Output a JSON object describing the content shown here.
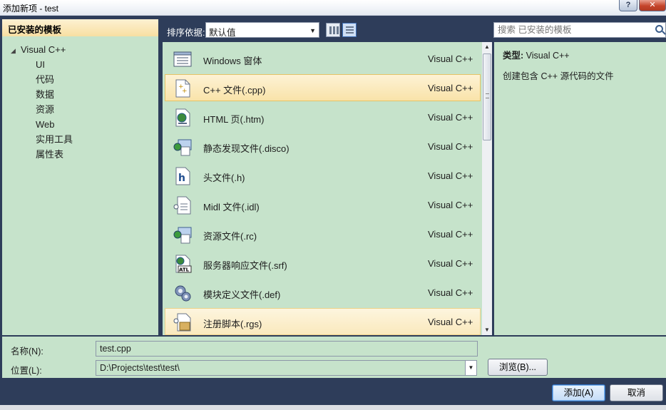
{
  "window": {
    "title": "添加新项 - test",
    "help_button": "?",
    "close_button": "✕"
  },
  "left_panel": {
    "header": "已安装的模板",
    "tree_root": "Visual C++",
    "tree_children": [
      "UI",
      "代码",
      "数据",
      "资源",
      "Web",
      "实用工具",
      "属性表"
    ]
  },
  "sortbar": {
    "label": "排序依据:",
    "selected": "默认值"
  },
  "search": {
    "placeholder": "搜索 已安装的模板"
  },
  "templates": [
    {
      "name": "Windows 窗体",
      "lang": "Visual C++",
      "icon": "windows-form-icon",
      "state": "normal"
    },
    {
      "name": "C++ 文件(.cpp)",
      "lang": "Visual C++",
      "icon": "cpp-file-icon",
      "state": "selected"
    },
    {
      "name": "HTML 页(.htm)",
      "lang": "Visual C++",
      "icon": "html-page-icon",
      "state": "normal"
    },
    {
      "name": "静态发现文件(.disco)",
      "lang": "Visual C++",
      "icon": "disco-file-icon",
      "state": "normal"
    },
    {
      "name": "头文件(.h)",
      "lang": "Visual C++",
      "icon": "header-file-icon",
      "state": "normal"
    },
    {
      "name": "Midl 文件(.idl)",
      "lang": "Visual C++",
      "icon": "midl-file-icon",
      "state": "normal"
    },
    {
      "name": "资源文件(.rc)",
      "lang": "Visual C++",
      "icon": "resource-file-icon",
      "state": "normal"
    },
    {
      "name": "服务器响应文件(.srf)",
      "lang": "Visual C++",
      "icon": "srf-file-icon",
      "state": "normal"
    },
    {
      "name": "模块定义文件(.def)",
      "lang": "Visual C++",
      "icon": "def-file-icon",
      "state": "normal"
    },
    {
      "name": "注册脚本(.rgs)",
      "lang": "Visual C++",
      "icon": "rgs-file-icon",
      "state": "hover"
    }
  ],
  "info": {
    "type_label": "类型:",
    "type_value": "Visual C++",
    "description": "创建包含 C++ 源代码的文件"
  },
  "form": {
    "name_label": "名称(N):",
    "name_value": "test.cpp",
    "location_label": "位置(L):",
    "location_value": "D:\\Projects\\test\\test\\",
    "browse_button": "浏览(B)..."
  },
  "footer": {
    "add_button": "添加(A)",
    "cancel_button": "取消"
  },
  "colors": {
    "panel_bg": "#c6e3cb",
    "dialog_bg": "#2e3d5a",
    "selection": "#f9e3a9",
    "header_bg": "#f8dfa2"
  }
}
